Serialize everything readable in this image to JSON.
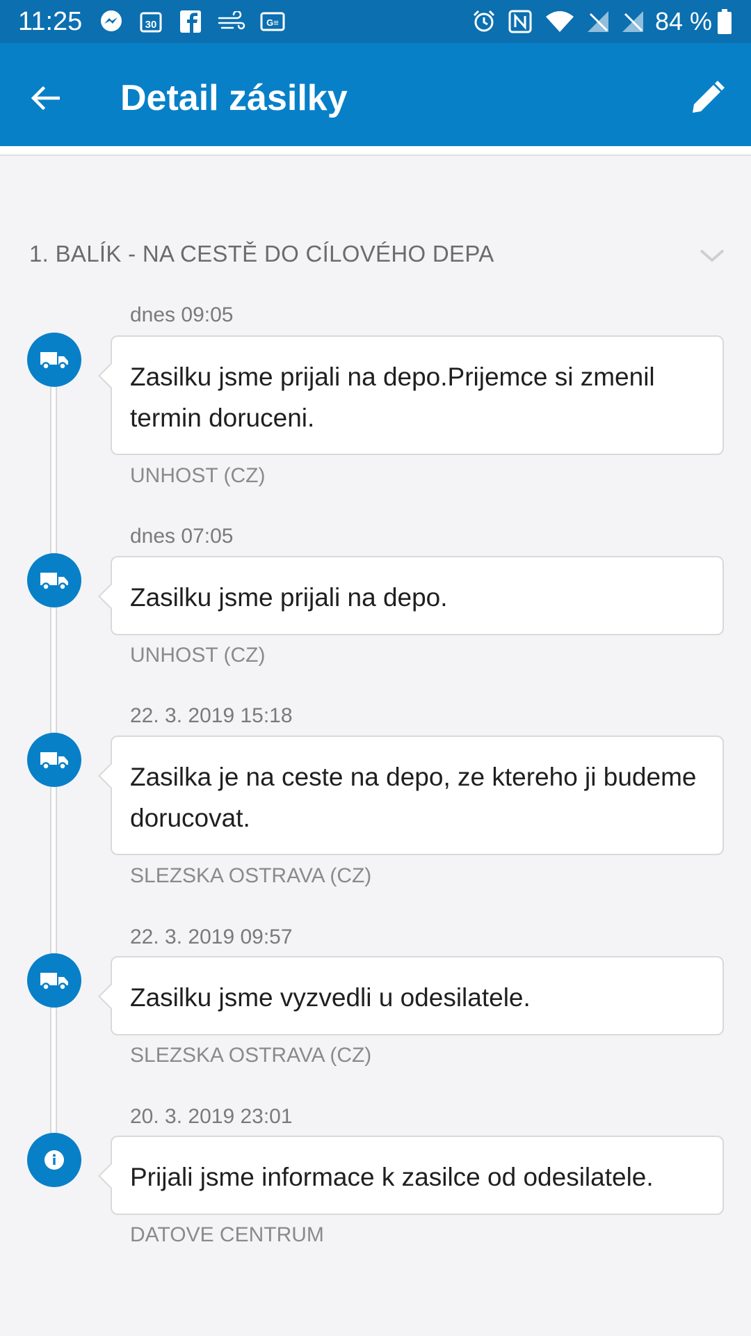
{
  "status_bar": {
    "time": "11:25",
    "battery": "84 %",
    "icons": [
      "messenger-icon",
      "calendar-icon",
      "facebook-icon",
      "wind-icon",
      "news-icon",
      "alarm-icon",
      "nfc-icon",
      "wifi-icon",
      "no-signal-icon",
      "no-signal-icon",
      "battery-icon"
    ]
  },
  "app_bar": {
    "title": "Detail zásilky",
    "back_icon": "arrow-back-icon",
    "edit_icon": "pencil-icon"
  },
  "section": {
    "title": "1. BALÍK - NA CESTĚ DO CÍLOVÉHO DEPA",
    "chevron_icon": "chevron-down-icon"
  },
  "events": [
    {
      "time": "dnes 09:05",
      "message": "Zasilku jsme prijali na depo.Prijemce si zmenil termin doruceni.",
      "location": "UNHOST (CZ)",
      "icon": "truck-icon"
    },
    {
      "time": "dnes 07:05",
      "message": "Zasilku jsme prijali na depo.",
      "location": "UNHOST (CZ)",
      "icon": "truck-icon"
    },
    {
      "time": "22. 3. 2019 15:18",
      "message": "Zasilka je na ceste na depo, ze ktereho ji budeme dorucovat.",
      "location": "SLEZSKA OSTRAVA (CZ)",
      "icon": "truck-icon"
    },
    {
      "time": "22. 3. 2019 09:57",
      "message": "Zasilku jsme vyzvedli u odesilatele.",
      "location": "SLEZSKA OSTRAVA (CZ)",
      "icon": "truck-icon"
    },
    {
      "time": "20. 3. 2019 23:01",
      "message": "Prijali jsme informace k zasilce od odesilatele.",
      "location": "DATOVE CENTRUM",
      "icon": "info-icon"
    }
  ],
  "colors": {
    "primary": "#0880c8",
    "status_bar": "#0b6fb0",
    "background": "#f4f4f6"
  }
}
